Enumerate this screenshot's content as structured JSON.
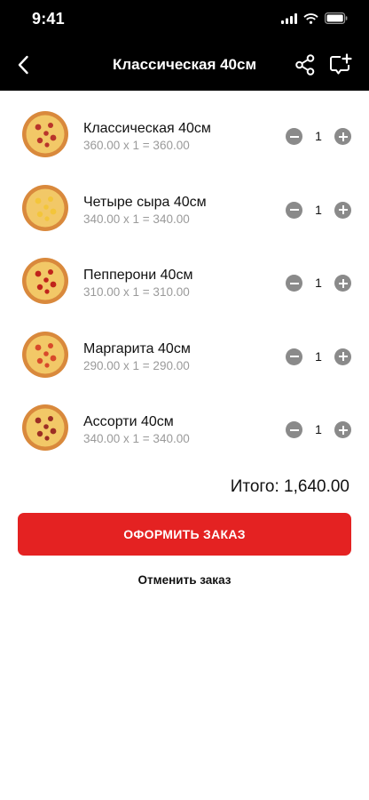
{
  "status_bar": {
    "time": "9:41"
  },
  "nav": {
    "title": "Классическая 40см"
  },
  "items": [
    {
      "name": "Классическая 40см",
      "calc": "360.00 x 1 = 360.00",
      "qty": "1",
      "topping": "#b9342a"
    },
    {
      "name": "Четыре сыра 40см",
      "calc": "340.00 x 1 = 340.00",
      "qty": "1",
      "topping": "#f3c53a"
    },
    {
      "name": "Пепперони 40см",
      "calc": "310.00 x 1 = 310.00",
      "qty": "1",
      "topping": "#c0241b"
    },
    {
      "name": "Маргарита 40см",
      "calc": "290.00 x 1 = 290.00",
      "qty": "1",
      "topping": "#d8492a"
    },
    {
      "name": "Ассорти 40см",
      "calc": "340.00 x 1 = 340.00",
      "qty": "1",
      "topping": "#9c2e24"
    }
  ],
  "total": "Итого: 1,640.00",
  "order_button": "ОФОРМИТЬ ЗАКАЗ",
  "cancel_link": "Отменить заказ",
  "colors": {
    "accent": "#e42222",
    "header": "#000000",
    "stepper": "#8a8a8a"
  }
}
